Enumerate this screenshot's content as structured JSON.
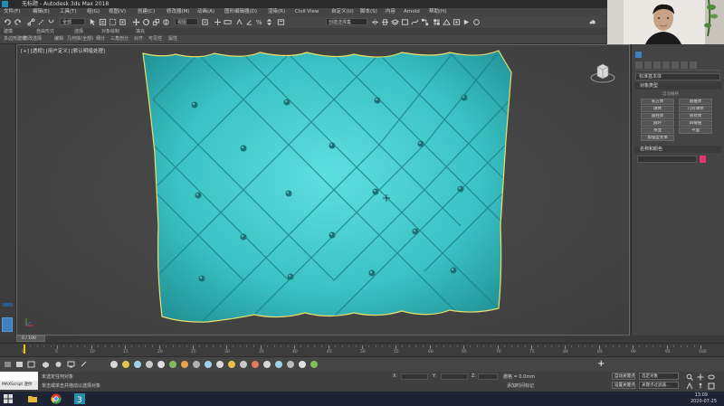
{
  "window": {
    "title": "无标题 - Autodesk 3ds Max 2018",
    "quick_access": "3ds ◂"
  },
  "menu": [
    "文件(F)",
    "编辑(E)",
    "工具(T)",
    "组(G)",
    "视图(V)",
    "创建(C)",
    "修改器(M)",
    "动画(A)",
    "图形编辑器(D)",
    "渲染(R)",
    "Civil View",
    "自定义(U)",
    "脚本(S)",
    "内容",
    "Arnold",
    "帮助(H)"
  ],
  "toolbar": {
    "selection_filter": "全部",
    "view_ref": "视图",
    "selection_set": "创建选择集"
  },
  "ribbon": {
    "row1": [
      "建模",
      "自由形式",
      "选择",
      "对象绘制",
      "填充"
    ],
    "row2": [
      "多边形建模",
      "修改选择",
      "编辑",
      "几何体(全部)",
      "细分",
      "三角剖分",
      "对齐",
      "可见性",
      "属性"
    ]
  },
  "viewport": {
    "label": "[+] [透视] [用户定义] [默认明暗处理]",
    "accent": "#3bc4c4"
  },
  "command_panel": {
    "category": "标准基本体",
    "section_title": "对象类型",
    "autogrid": "自动栅格",
    "buttons": [
      "长方体",
      "圆锥体",
      "球体",
      "几何球体",
      "圆柱体",
      "管状体",
      "圆环",
      "四棱锥",
      "茶壶",
      "平面",
      "加强型文本"
    ],
    "name_color_section": "名称和颜色",
    "swatch_color": "#e3366b"
  },
  "timeline": {
    "frame_display": "0 / 100",
    "ticks": [
      "0",
      "5",
      "10",
      "15",
      "20",
      "25",
      "30",
      "35",
      "40",
      "45",
      "50",
      "55",
      "60",
      "65",
      "70",
      "75",
      "80",
      "85",
      "90",
      "95",
      "100"
    ]
  },
  "status": {
    "maxscript": "MAXScript 迷你",
    "line1": "未选定任何对象",
    "line2": "单击或单击并拖动以选择对象",
    "x_label": "X:",
    "y_label": "Y:",
    "z_label": "Z:",
    "grid": "栅格 = 0.0mm",
    "add_time_tag": "添加时间标记",
    "auto_key": "自动关键点",
    "selected": "选定对象",
    "set_key": "设置关键点",
    "key_filters": "关键点过滤器..."
  },
  "taskbar": {
    "time": "13:09",
    "date": "2020-07-25"
  }
}
